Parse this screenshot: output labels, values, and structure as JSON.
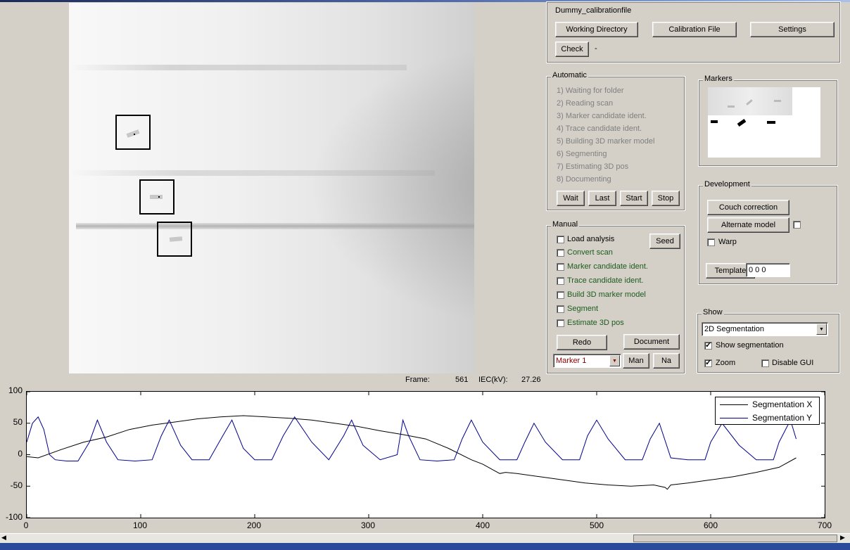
{
  "config": {
    "calibration_name": "Dummy_calibrationfile",
    "working_dir_label": "Working Directory",
    "calibration_file_label": "Calibration File",
    "settings_label": "Settings",
    "check_label": "Check",
    "check_status": "-"
  },
  "automatic": {
    "title": "Automatic",
    "steps": [
      "1) Waiting for folder",
      "2) Reading scan",
      "3) Marker candidate ident.",
      "4) Trace candidate ident.",
      "5) Building 3D marker model",
      "6) Segmenting",
      "7) Estimating 3D pos",
      "8) Documenting"
    ],
    "buttons": [
      "Wait",
      "Last",
      "Start",
      "Stop"
    ]
  },
  "markers": {
    "title": "Markers"
  },
  "manual": {
    "title": "Manual",
    "items": [
      "Load analysis",
      "Convert scan",
      "Marker candidate ident.",
      "Trace candidate ident.",
      "Build 3D marker model",
      "Segment",
      "Estimate 3D pos"
    ],
    "seed_label": "Seed",
    "redo_label": "Redo",
    "document_label": "Document",
    "marker_select": "Marker 1",
    "man_label": "Man",
    "na_label": "Na"
  },
  "development": {
    "title": "Development",
    "couch_label": "Couch correction",
    "alternate_label": "Alternate model",
    "warp_label": "Warp",
    "template_label": "Template",
    "template_value": "0  0  0"
  },
  "show": {
    "title": "Show",
    "view_select": "2D Segmentation",
    "show_seg_label": "Show segmentation",
    "zoom_label": "Zoom",
    "disable_gui_label": "Disable GUI"
  },
  "status": {
    "frame_label": "Frame:",
    "frame_value": "561",
    "iec_label": "IEC(kV):",
    "iec_value": "27.26"
  },
  "chart_data": {
    "type": "line",
    "xlim": [
      0,
      700
    ],
    "ylim": [
      -100,
      100
    ],
    "xticks": [
      "0",
      "100",
      "200",
      "300",
      "400",
      "500",
      "600",
      "700"
    ],
    "yticks": [
      "100",
      "50",
      "0",
      "-50",
      "-100"
    ],
    "legend_placement": "top-right",
    "series": [
      {
        "name": "Segmentation X",
        "color": "#000000",
        "x": [
          0,
          10,
          30,
          50,
          70,
          90,
          110,
          130,
          150,
          170,
          190,
          210,
          230,
          250,
          270,
          290,
          310,
          330,
          350,
          370,
          390,
          400,
          410,
          415,
          420,
          430,
          450,
          470,
          490,
          510,
          530,
          550,
          560,
          562,
          565,
          580,
          600,
          620,
          640,
          660,
          675
        ],
        "y": [
          -3,
          -5,
          8,
          20,
          28,
          40,
          47,
          52,
          57,
          60,
          62,
          60,
          58,
          55,
          50,
          45,
          38,
          32,
          25,
          10,
          -8,
          -15,
          -25,
          -30,
          -28,
          -30,
          -35,
          -40,
          -45,
          -48,
          -50,
          -48,
          -52,
          -55,
          -48,
          -45,
          -40,
          -35,
          -28,
          -20,
          -5
        ]
      },
      {
        "name": "Segmentation Y",
        "color": "#00008b",
        "x": [
          0,
          5,
          10,
          15,
          20,
          25,
          35,
          45,
          55,
          62,
          70,
          80,
          95,
          110,
          118,
          125,
          135,
          145,
          160,
          172,
          180,
          190,
          200,
          215,
          225,
          235,
          250,
          265,
          278,
          285,
          295,
          310,
          325,
          330,
          335,
          345,
          360,
          375,
          382,
          390,
          400,
          415,
          430,
          437,
          445,
          455,
          470,
          485,
          492,
          500,
          510,
          525,
          540,
          547,
          555,
          565,
          580,
          595,
          600,
          610,
          625,
          640,
          655,
          660,
          670,
          675
        ],
        "y": [
          20,
          50,
          60,
          40,
          0,
          -8,
          -10,
          -10,
          20,
          55,
          20,
          -8,
          -10,
          -8,
          30,
          55,
          15,
          -8,
          -8,
          30,
          55,
          10,
          -8,
          -8,
          30,
          60,
          20,
          -8,
          30,
          55,
          15,
          -8,
          0,
          55,
          30,
          -8,
          -10,
          -8,
          25,
          55,
          20,
          -8,
          -8,
          20,
          50,
          20,
          -8,
          -8,
          30,
          55,
          25,
          -8,
          -8,
          25,
          50,
          -5,
          -8,
          -8,
          20,
          50,
          15,
          -8,
          -8,
          20,
          55,
          25
        ]
      }
    ]
  }
}
